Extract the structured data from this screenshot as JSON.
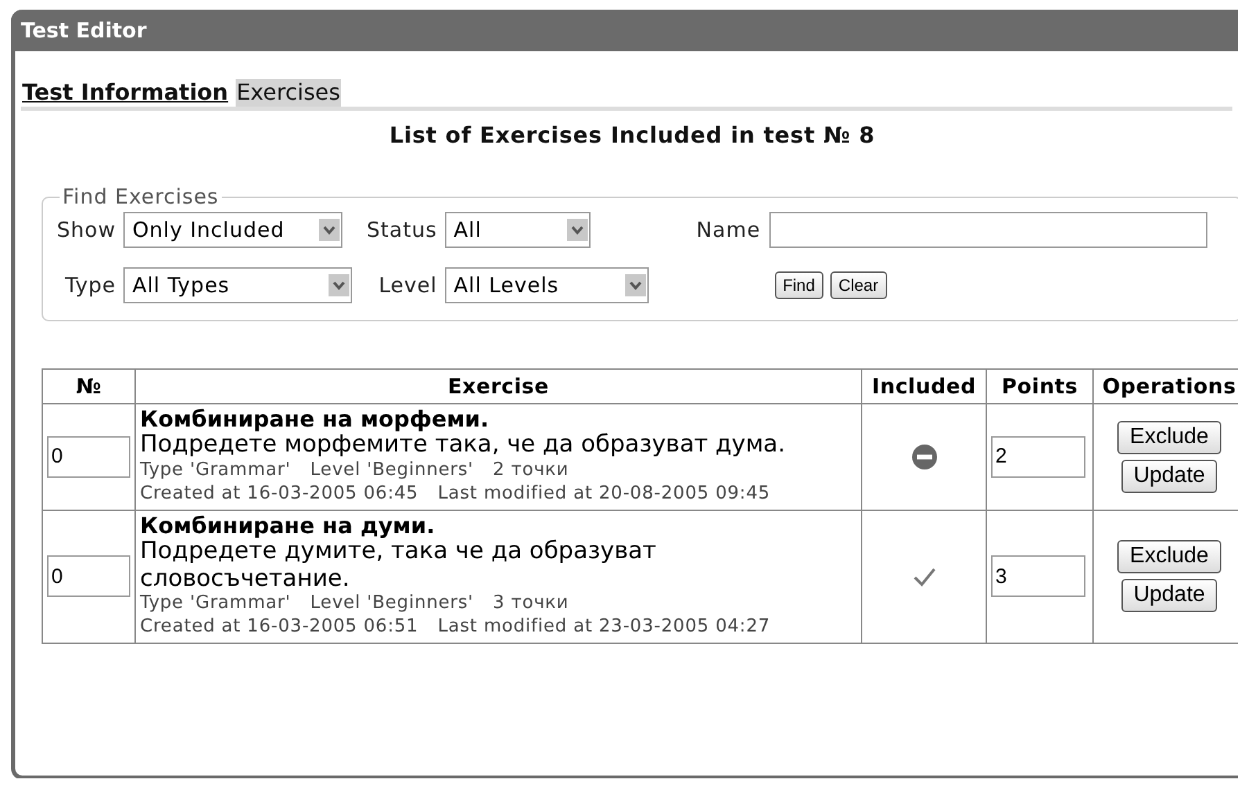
{
  "window": {
    "title": "Test Editor"
  },
  "tabs": [
    {
      "label": "Test Information",
      "selected": false
    },
    {
      "label": "Exercises",
      "selected": true
    }
  ],
  "heading": "List of Exercises Included in test № 8",
  "find": {
    "legend": "Find Exercises",
    "fields": [
      {
        "label": "Show",
        "value": "Only Included",
        "kind": "select"
      },
      {
        "label": "Status",
        "value": "All",
        "kind": "select"
      },
      {
        "label": "Name",
        "kind": "text"
      },
      {
        "label": "Type",
        "value": "All Types",
        "kind": "select"
      },
      {
        "label": "Level",
        "value": "All Levels",
        "kind": "select"
      }
    ],
    "buttons": [
      "Find",
      "Clear"
    ]
  },
  "table": {
    "columns": [
      "№",
      "Exercise",
      "Included",
      "Points",
      "Operations"
    ],
    "rows": [
      {
        "order": "0",
        "title": "Комбиниране на морфеми.",
        "description": "Подредете морфемите така, че да образуват дума.",
        "type": "Type 'Grammar'",
        "level": "Level 'Beginners'",
        "points_label": "2 точки",
        "created": "Created at 16-03-2005 06:45",
        "modified": "Last modified at 20-08-2005 09:45",
        "kind": "minus",
        "points": "2",
        "buttons": [
          "Exclude",
          "Update"
        ]
      },
      {
        "order": "0",
        "title": "Комбиниране на думи.",
        "description": "Подредете думите, така че да образуват словосъчетание.",
        "type": "Type 'Grammar'",
        "level": "Level 'Beginners'",
        "points_label": "3 точки",
        "created": "Created at 16-03-2005 06:51",
        "modified": "Last modified at 23-03-2005 04:27",
        "kind": "check",
        "points": "3",
        "buttons": [
          "Exclude",
          "Update"
        ]
      }
    ]
  }
}
